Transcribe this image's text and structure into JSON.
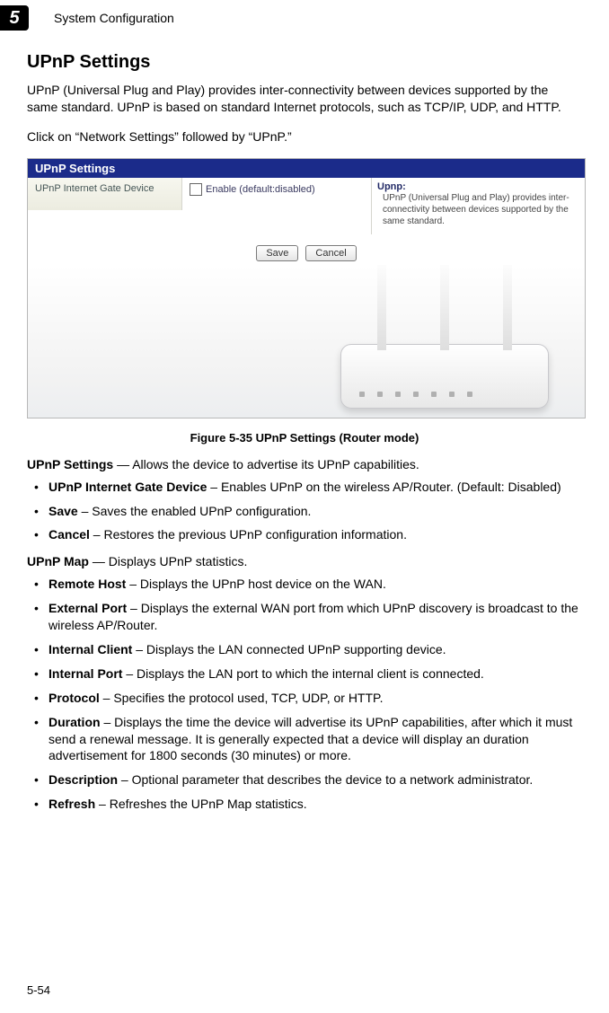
{
  "chapter_number": "5",
  "header_title": "System Configuration",
  "section_heading": "UPnP Settings",
  "intro_para": "UPnP (Universal Plug and Play) provides inter-connectivity between devices supported by the same standard. UPnP is based on standard Internet protocols, such as TCP/IP, UDP, and HTTP.",
  "click_para": "Click on “Network Settings” followed by “UPnP.”",
  "screenshot": {
    "bar_title": "UPnP Settings",
    "left_label": "UPnP Internet Gate Device",
    "checkbox_label": "Enable (default:disabled)",
    "help_title": "Upnp:",
    "help_text": "UPnP (Universal Plug and Play) provides inter-connectivity between devices supported by the same standard.",
    "save_label": "Save",
    "cancel_label": "Cancel"
  },
  "figure_caption": "Figure 5-35  UPnP Settings (Router mode)",
  "upnp_settings_lead_bold": "UPnP Settings",
  "upnp_settings_lead_rest": " — Allows the device to advertise its UPnP capabilities.",
  "settings_bullets": [
    {
      "bold": "UPnP Internet Gate Device",
      "rest": " – Enables UPnP on the wireless AP/Router. (Default: Disabled)"
    },
    {
      "bold": "Save",
      "rest": " – Saves the enabled UPnP configuration."
    },
    {
      "bold": "Cancel",
      "rest": " – Restores the previous UPnP configuration information."
    }
  ],
  "upnp_map_lead_bold": "UPnP Map",
  "upnp_map_lead_rest": " — Displays UPnP statistics.",
  "map_bullets": [
    {
      "bold": "Remote Host",
      "rest": " – Displays the UPnP host device on the WAN."
    },
    {
      "bold": "External Port",
      "rest": " – Displays the external WAN port from which UPnP discovery is broadcast to the wireless AP/Router."
    },
    {
      "bold": "Internal Client",
      "rest": " – Displays the LAN connected UPnP supporting device."
    },
    {
      "bold": "Internal Port",
      "rest": " – Displays the LAN port to which the internal client is connected."
    },
    {
      "bold": "Protocol",
      "rest": " – Specifies the protocol used, TCP, UDP, or HTTP."
    },
    {
      "bold": "Duration",
      "rest": " – Displays the time the device will advertise its UPnP capabilities, after which it must send a renewal message. It is generally expected that a device will display an duration advertisement for 1800 seconds (30 minutes) or more."
    },
    {
      "bold": "Description",
      "rest": " – Optional parameter that describes the device to a network administrator."
    },
    {
      "bold": "Refresh",
      "rest": " – Refreshes the UPnP Map statistics."
    }
  ],
  "page_number": "5-54"
}
